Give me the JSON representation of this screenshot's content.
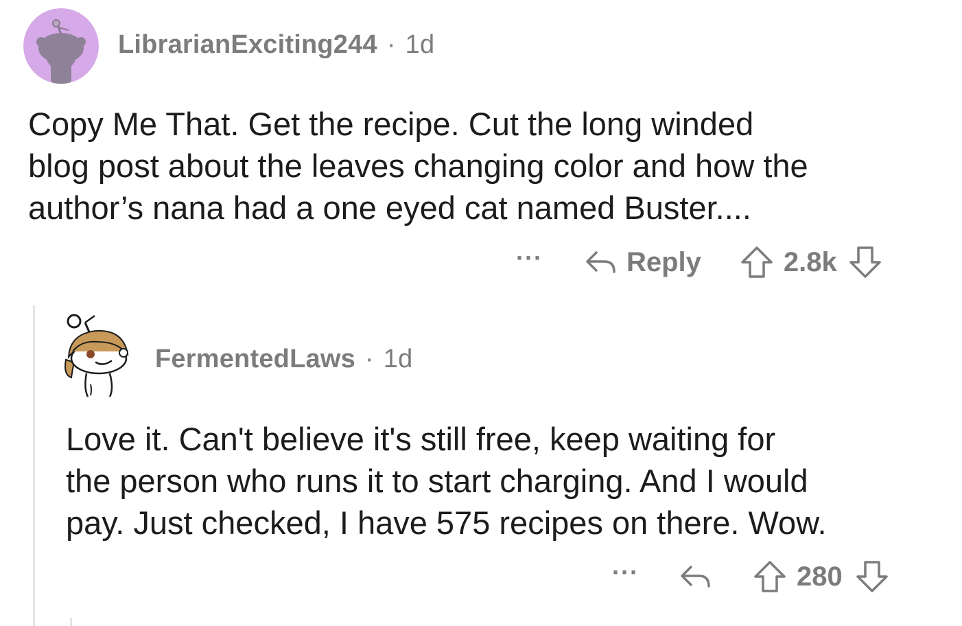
{
  "comments": [
    {
      "username": "LibrarianExciting244",
      "separator": "·",
      "age": "1d",
      "lines": [
        "Copy Me That.  Get the recipe.  Cut the long winded",
        "blog post about the leaves changing color and how the",
        "author’s nana had a one eyed cat named Buster...."
      ],
      "more_label": "···",
      "reply_label": "Reply",
      "score": "2.8k",
      "icons": {
        "avatar": "snoo-avatar-icon",
        "reply": "reply-arrow-icon",
        "upvote": "upvote-arrow-icon",
        "downvote": "downvote-arrow-icon"
      },
      "colors": {
        "avatar_bg": "#d6a9e8"
      }
    },
    {
      "username": "FermentedLaws",
      "separator": "·",
      "age": "1d",
      "lines": [
        "Love it. Can't believe it's still free, keep waiting for",
        "the person who runs it to start charging. And I would",
        "pay. Just checked, I have 575 recipes on there. Wow."
      ],
      "more_label": "···",
      "score": "280",
      "icons": {
        "avatar": "snoo-avatar-icon",
        "reply": "reply-arrow-icon",
        "upvote": "upvote-arrow-icon",
        "downvote": "downvote-arrow-icon"
      },
      "colors": {
        "avatar_bg": "#ffffff"
      }
    }
  ],
  "colors": {
    "text": "#1c1c1c",
    "meta": "#7c7c7c",
    "thread_line": "#e4e4e4"
  }
}
